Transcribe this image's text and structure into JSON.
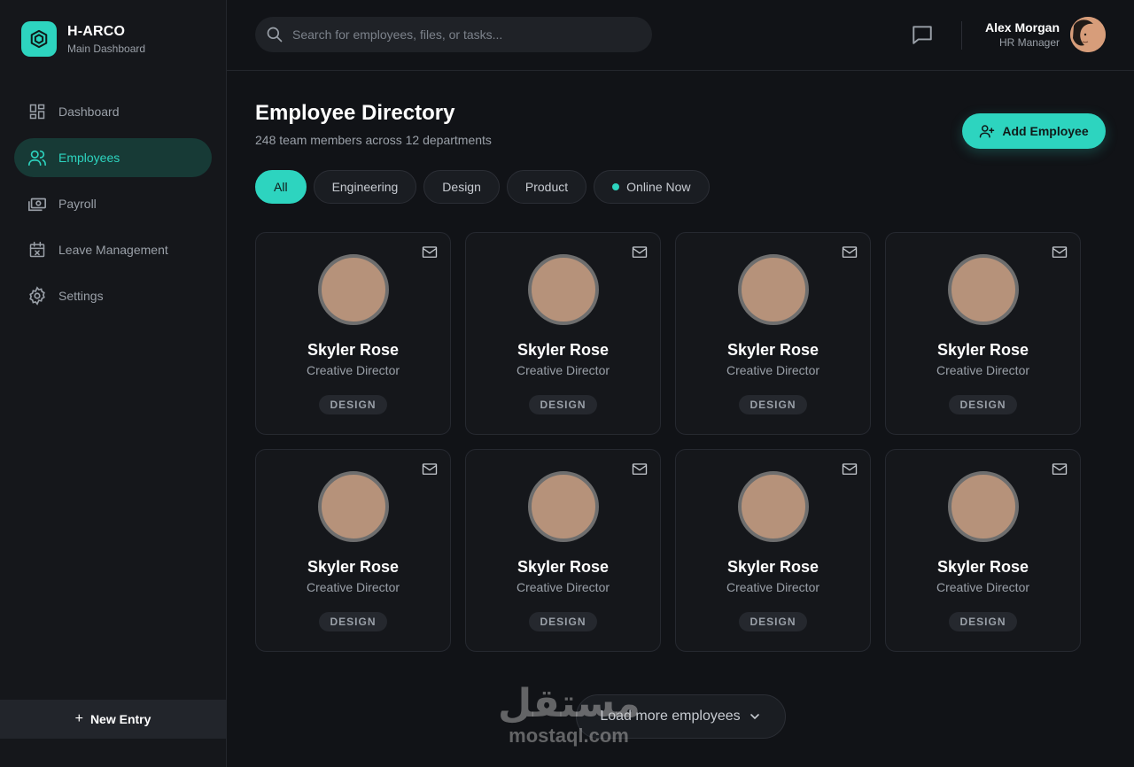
{
  "brand": {
    "name": "H-ARCO",
    "subtitle": "Main Dashboard",
    "accent": "#2dd4bf"
  },
  "sidebar": {
    "items": [
      {
        "label": "Dashboard",
        "icon": "dashboard-grid-icon",
        "active": false
      },
      {
        "label": "Employees",
        "icon": "users-icon",
        "active": true
      },
      {
        "label": "Payroll",
        "icon": "cash-icon",
        "active": false
      },
      {
        "label": "Leave Management",
        "icon": "calendar-x-icon",
        "active": false
      },
      {
        "label": "Settings",
        "icon": "gear-icon",
        "active": false
      }
    ],
    "new_entry": "New Entry"
  },
  "topbar": {
    "search_placeholder": "Search for employees, files, or tasks...",
    "user": {
      "name": "Alex Morgan",
      "role": "HR Manager"
    }
  },
  "main": {
    "title": "Employee Directory",
    "subtitle": "248 team members across 12 departments",
    "add_button": "Add Employee",
    "filters": [
      {
        "label": "All",
        "active": true
      },
      {
        "label": "Engineering",
        "active": false
      },
      {
        "label": "Design",
        "active": false
      },
      {
        "label": "Product",
        "active": false
      },
      {
        "label": "Online Now",
        "active": false,
        "status_dot": true
      }
    ],
    "employees": [
      {
        "name": "Skyler Rose",
        "role": "Creative Director",
        "department": "DESIGN"
      },
      {
        "name": "Skyler Rose",
        "role": "Creative Director",
        "department": "DESIGN"
      },
      {
        "name": "Skyler Rose",
        "role": "Creative Director",
        "department": "DESIGN"
      },
      {
        "name": "Skyler Rose",
        "role": "Creative Director",
        "department": "DESIGN"
      },
      {
        "name": "Skyler Rose",
        "role": "Creative Director",
        "department": "DESIGN"
      },
      {
        "name": "Skyler Rose",
        "role": "Creative Director",
        "department": "DESIGN"
      },
      {
        "name": "Skyler Rose",
        "role": "Creative Director",
        "department": "DESIGN"
      },
      {
        "name": "Skyler Rose",
        "role": "Creative Director",
        "department": "DESIGN"
      }
    ],
    "load_more": "Load more employees"
  },
  "watermark": {
    "arabic": "مستقل",
    "latin": "mostaql.com"
  }
}
